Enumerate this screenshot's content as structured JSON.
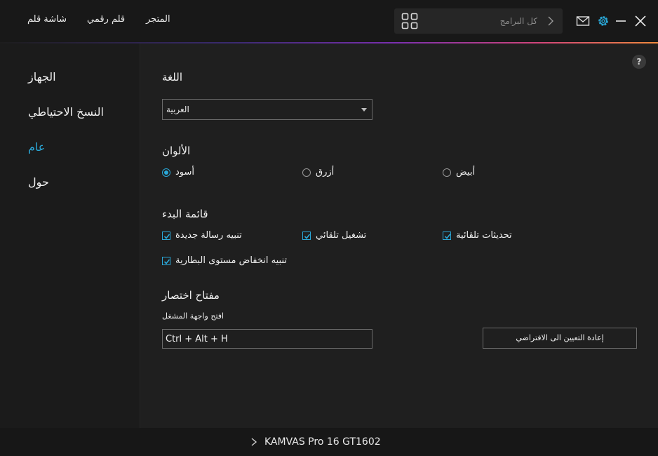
{
  "header": {
    "nav": [
      "شاشة قلم",
      "قلم رقمي",
      "المتجر"
    ],
    "search_placeholder": "كل البرامج",
    "icons": [
      "apps-grid-icon",
      "chevron-right-icon",
      "mail-icon",
      "gear-icon",
      "minimize-icon",
      "close-icon"
    ],
    "accent_color": "#2aa8d8"
  },
  "sidebar": {
    "items": [
      {
        "label": "الجهاز",
        "active": false
      },
      {
        "label": "النسخ الاحتياطي",
        "active": false
      },
      {
        "label": "عام",
        "active": true
      },
      {
        "label": "حول",
        "active": false
      }
    ]
  },
  "main": {
    "help": "?",
    "language": {
      "title": "اللغة",
      "selected": "العربية"
    },
    "colors": {
      "title": "الألوان",
      "options": [
        {
          "label": "أسود",
          "selected": true
        },
        {
          "label": "أزرق",
          "selected": false
        },
        {
          "label": "أبيض",
          "selected": false
        }
      ]
    },
    "startup": {
      "title": "قائمة البدء",
      "options": [
        {
          "label": "تنبيه رسالة جديدة",
          "checked": true
        },
        {
          "label": "تشغيل تلقائي",
          "checked": true
        },
        {
          "label": "تحديثات تلقائية",
          "checked": true
        },
        {
          "label": "تنبيه انخفاض مستوى البطارية",
          "checked": true
        }
      ]
    },
    "shortcut": {
      "title": "مفتاح اختصار",
      "sublabel": "افتح واجهة المشغل",
      "value": "Ctrl + Alt + H",
      "reset_label": "إعادة التعيين الى الافتراضي"
    }
  },
  "footer": {
    "device": "KAMVAS Pro 16 GT1602"
  }
}
